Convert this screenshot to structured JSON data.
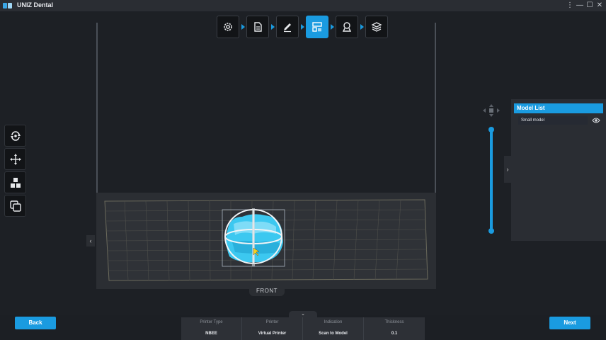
{
  "app": {
    "title": "UNIZ Dental"
  },
  "window_controls": {
    "menu": "⋮",
    "minimize": "—",
    "maximize": "☐",
    "close": "✕"
  },
  "steps": [
    {
      "name": "settings",
      "icon": "gear-icon",
      "active": false
    },
    {
      "name": "document",
      "icon": "document-icon",
      "active": false
    },
    {
      "name": "edit",
      "icon": "pen-icon",
      "active": false
    },
    {
      "name": "layout",
      "icon": "layout-icon",
      "active": true
    },
    {
      "name": "support",
      "icon": "support-icon",
      "active": false
    },
    {
      "name": "layers",
      "icon": "layers-icon",
      "active": false
    }
  ],
  "left_tools": [
    "rotate-icon",
    "move-icon",
    "arrange-icon",
    "copy-icon"
  ],
  "viewport": {
    "front_label": "FRONT"
  },
  "model_list": {
    "title": "Model List",
    "items": [
      {
        "name": "Small model",
        "visible": true
      }
    ]
  },
  "slider": {
    "level": 1.0
  },
  "buttons": {
    "back": "Back",
    "next": "Next"
  },
  "info": {
    "headers": [
      "Printer Type",
      "Printer",
      "Indication",
      "Thickness"
    ],
    "values": [
      "NBEE",
      "Virtual Printer",
      "Scan to Model",
      "0.1"
    ]
  },
  "colors": {
    "accent": "#1a9be0",
    "background": "#1e2126",
    "model": "#3cc8f0"
  }
}
